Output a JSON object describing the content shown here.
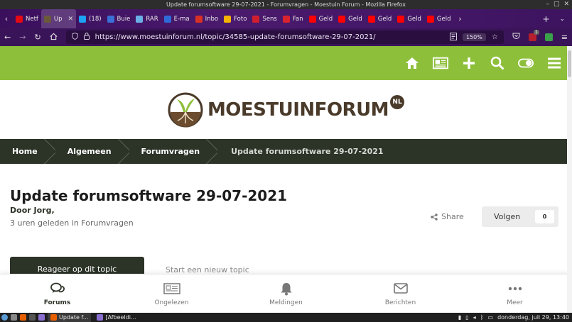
{
  "window": {
    "title": "Update forumsoftware 29-07-2021 - Forumvragen - Moestuin Forum - Mozilla Firefox"
  },
  "tabs": [
    {
      "label": "Netf",
      "icon": "netflix-icon",
      "color": "#e50914"
    },
    {
      "label": "Up",
      "icon": "moestuin-icon",
      "color": "#6b5a3a",
      "active": true
    },
    {
      "label": "(18)",
      "icon": "twitter-icon",
      "color": "#1da1f2"
    },
    {
      "label": "Buie",
      "icon": "buienradar-icon",
      "color": "#3a6fd6"
    },
    {
      "label": "RAR",
      "icon": "r-icon",
      "color": "#6ab0e6"
    },
    {
      "label": "E-ma",
      "icon": "mail-icon",
      "color": "#2f6ad9"
    },
    {
      "label": "Inbo",
      "icon": "gmail-icon",
      "color": "#d93025"
    },
    {
      "label": "Foto",
      "icon": "photos-icon",
      "color": "#f4b400"
    },
    {
      "label": "Sens",
      "icon": "sensor-icon",
      "color": "#cf1f2e"
    },
    {
      "label": "Fan",
      "icon": "fan-icon",
      "color": "#d9232e"
    },
    {
      "label": "Geld",
      "icon": "youtube-icon",
      "color": "#ff0000"
    },
    {
      "label": "Geld",
      "icon": "youtube-icon",
      "color": "#ff0000"
    },
    {
      "label": "Geld",
      "icon": "youtube-icon",
      "color": "#ff0000"
    },
    {
      "label": "Geld",
      "icon": "youtube-icon",
      "color": "#ff0000"
    },
    {
      "label": "Geld",
      "icon": "youtube-icon",
      "color": "#ff0000"
    }
  ],
  "nav": {
    "url": "https://www.moestuinforum.nl/topic/34585-update-forumsoftware-29-07-2021/",
    "zoom": "150%",
    "extension_badge": "1"
  },
  "site": {
    "logo_text": "MOESTUINFORUM",
    "logo_badge": "NL",
    "accent": "#8dbf3a",
    "dark": "#2c3327"
  },
  "breadcrumb": [
    "Home",
    "Algemeen",
    "Forumvragen",
    "Update forumsoftware 29-07-2021"
  ],
  "topic": {
    "title": "Update forumsoftware 29-07-2021",
    "author": "Door Jorg,",
    "meta": "3 uren geleden in Forumvragen",
    "share_label": "Share",
    "follow_label": "Volgen",
    "follow_count": "0",
    "reply_button": "Reageer op dit topic",
    "new_topic": "Start een nieuw topic"
  },
  "bottom_nav": [
    {
      "label": "Forums",
      "icon": "forums-icon",
      "active": true
    },
    {
      "label": "Ongelezen",
      "icon": "newspaper-icon"
    },
    {
      "label": "Meldingen",
      "icon": "bell-icon"
    },
    {
      "label": "Berichten",
      "icon": "envelope-icon"
    },
    {
      "label": "Meer",
      "icon": "more-icon"
    }
  ],
  "taskbar": {
    "tasks": [
      "Update f...",
      "[Afbeeldi..."
    ],
    "clock": "donderdag, juli 29, 13:40"
  }
}
